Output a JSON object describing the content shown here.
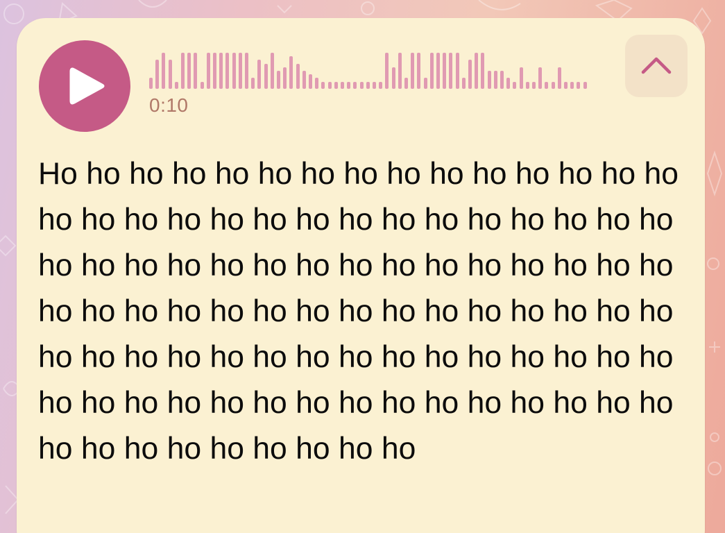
{
  "voice_message": {
    "duration": "0:10",
    "play_icon": "play-icon",
    "collapse_icon": "chevron-up-icon",
    "waveform_levels": [
      0.3,
      0.8,
      1,
      0.8,
      0.2,
      1,
      1,
      1,
      0.2,
      1,
      1,
      1,
      1,
      1,
      1,
      1,
      0.3,
      0.8,
      0.7,
      1,
      0.5,
      0.6,
      0.9,
      0.7,
      0.5,
      0.4,
      0.3,
      0.2,
      0.2,
      0.2,
      0.2,
      0.2,
      0.2,
      0.2,
      0.2,
      0.2,
      0.2,
      1,
      0.6,
      1,
      0.3,
      1,
      1,
      0.3,
      1,
      1,
      1,
      1,
      1,
      0.3,
      0.8,
      1,
      1,
      0.5,
      0.5,
      0.5,
      0.3,
      0.2,
      0.6,
      0.2,
      0.2,
      0.6,
      0.2,
      0.2,
      0.6,
      0.2,
      0.2,
      0.2,
      0.2
    ],
    "transcript": "Ho ho ho ho ho ho ho ho ho ho ho ho ho ho ho ho ho ho ho ho ho ho ho ho ho ho ho ho ho ho ho ho ho ho ho ho ho ho ho ho ho ho ho ho ho ho ho ho ho ho ho ho ho ho ho ho ho ho ho ho ho ho ho ho ho ho ho ho ho ho ho ho ho ho ho ho ho ho ho ho ho ho ho ho ho ho ho ho ho ho ho ho ho ho ho ho ho ho ho"
  },
  "colors": {
    "accent": "#c55a86",
    "waveform": "#e09ab2",
    "bubble": "#fbf1d2",
    "duration_text": "#b07868"
  }
}
